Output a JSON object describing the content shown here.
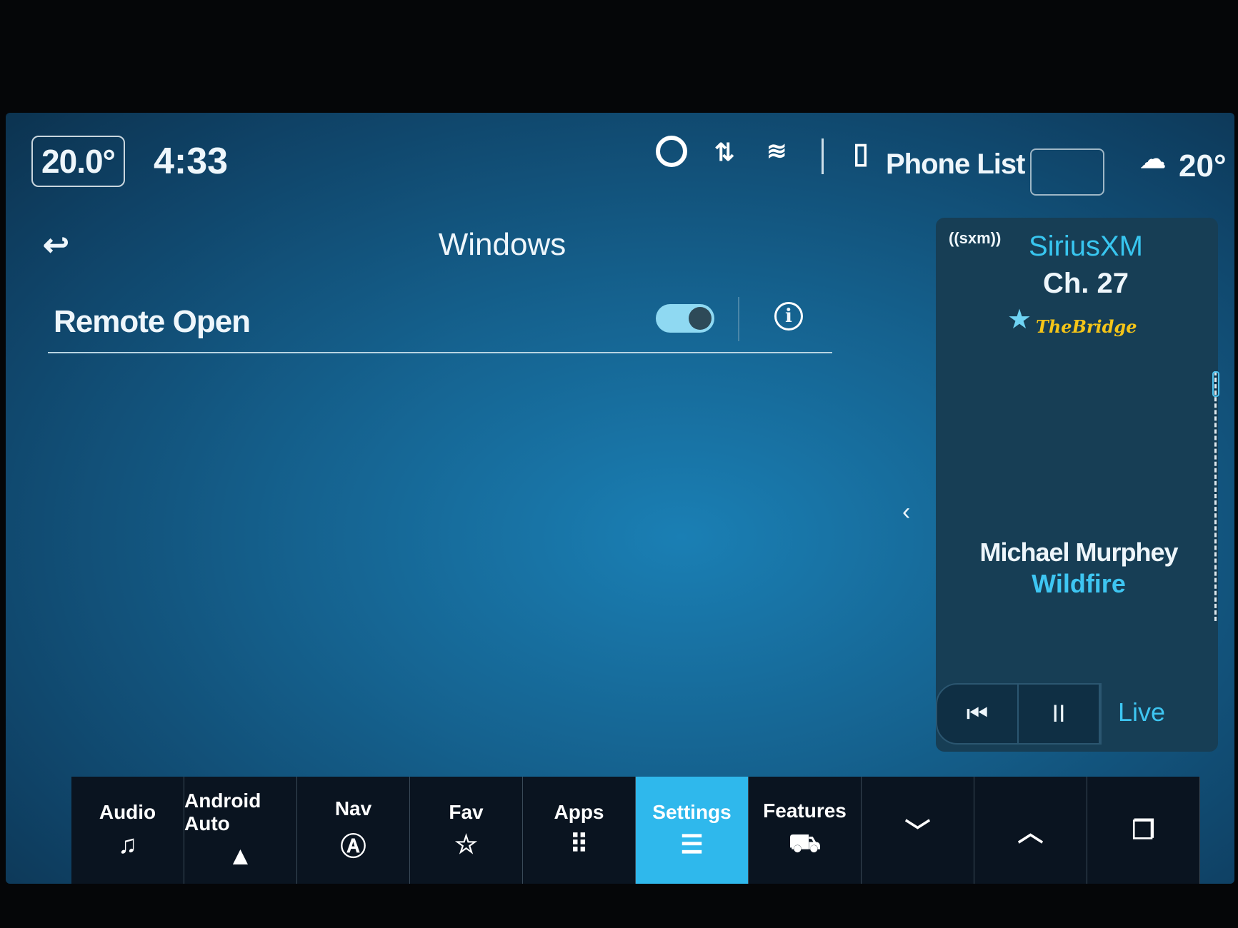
{
  "status_bar": {
    "cabin_temp": "20.0°",
    "time": "4:33",
    "icons": [
      "alexa-icon",
      "data-transfer-icon",
      "wifi-icon",
      "phone-icon"
    ],
    "phone_label": "Phone List",
    "outside_temp": "20°",
    "weather_icon": "cloud-thermometer-icon"
  },
  "main": {
    "title": "Windows",
    "back_icon": "back-arrow-icon",
    "setting": {
      "label": "Remote Open",
      "toggle_on": true,
      "info_icon": "info-icon"
    }
  },
  "media": {
    "logo": "sxm",
    "source": "SiriusXM",
    "channel": "Ch. 27",
    "favorite_icon": "star-icon",
    "station_logo": "TheBridge",
    "artist": "Michael Murphey",
    "song": "Wildfire",
    "controls": {
      "rewind": "⏮",
      "pause": "II"
    },
    "live_label": "Live",
    "accent": "#38c6f0"
  },
  "nav": {
    "items": [
      {
        "label": "Audio",
        "icon": "♫"
      },
      {
        "label": "Android Auto",
        "icon": "▲"
      },
      {
        "label": "Nav",
        "icon": "Ⓐ"
      },
      {
        "label": "Fav",
        "icon": "☆"
      },
      {
        "label": "Apps",
        "icon": "⠿"
      },
      {
        "label": "Settings",
        "icon": "☰",
        "active": true
      },
      {
        "label": "Features",
        "icon": "⛟"
      },
      {
        "label": "",
        "icon": "﹀"
      },
      {
        "label": "",
        "icon": "︿"
      },
      {
        "label": "",
        "icon": "❐"
      }
    ],
    "active_color": "#2fb8ec"
  }
}
